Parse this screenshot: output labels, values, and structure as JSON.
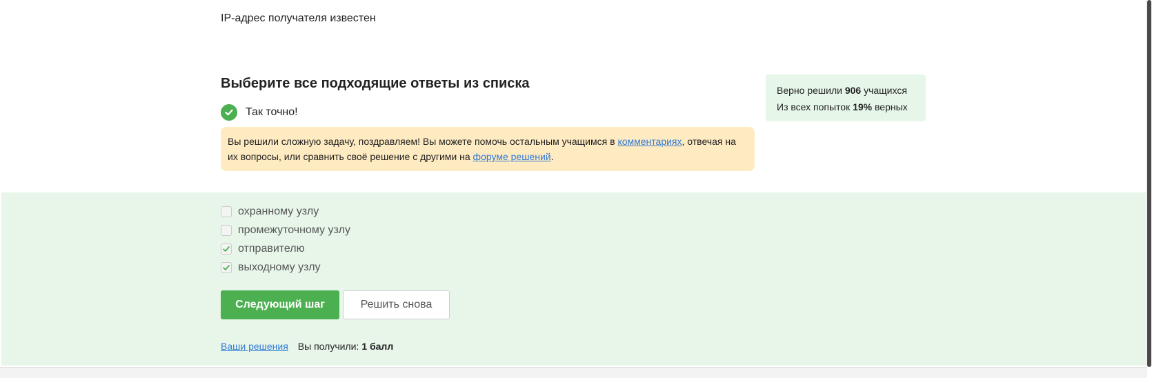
{
  "prev_question": {
    "option_text": "IP-адрес получателя известен"
  },
  "question": {
    "heading": "Выберите все подходящие ответы из списка",
    "result_text": "Так точно!",
    "notice": {
      "part1": "Вы решили сложную задачу, поздравляем! Вы можете помочь остальным учащимся в ",
      "link1": "комментариях",
      "part2": ", отвечая на их вопросы, или сравнить своё решение с другими на ",
      "link2": "форуме решений",
      "part3": "."
    }
  },
  "stats": {
    "solved_prefix": "Верно решили ",
    "solved_count": "906",
    "solved_suffix": " учащихся",
    "attempts_prefix": "Из всех попыток ",
    "attempts_percent": "19%",
    "attempts_suffix": " верных"
  },
  "options": [
    {
      "label": "охранному узлу",
      "checked": false
    },
    {
      "label": "промежуточному узлу",
      "checked": false
    },
    {
      "label": "отправителю",
      "checked": true
    },
    {
      "label": "выходному узлу",
      "checked": true
    }
  ],
  "buttons": {
    "next_step": "Следующий шаг",
    "solve_again": "Решить снова"
  },
  "footer": {
    "your_solutions": "Ваши решения",
    "score_label": "Вы получили:",
    "score_value": "1 балл"
  },
  "colors": {
    "accent_green": "#4caf50",
    "panel_green": "#e8f6ea",
    "notice_yellow": "#ffebc2",
    "link_blue": "#2f7ad6"
  },
  "icons": {
    "success": "check-circle-icon",
    "checked": "checkmark-icon"
  }
}
